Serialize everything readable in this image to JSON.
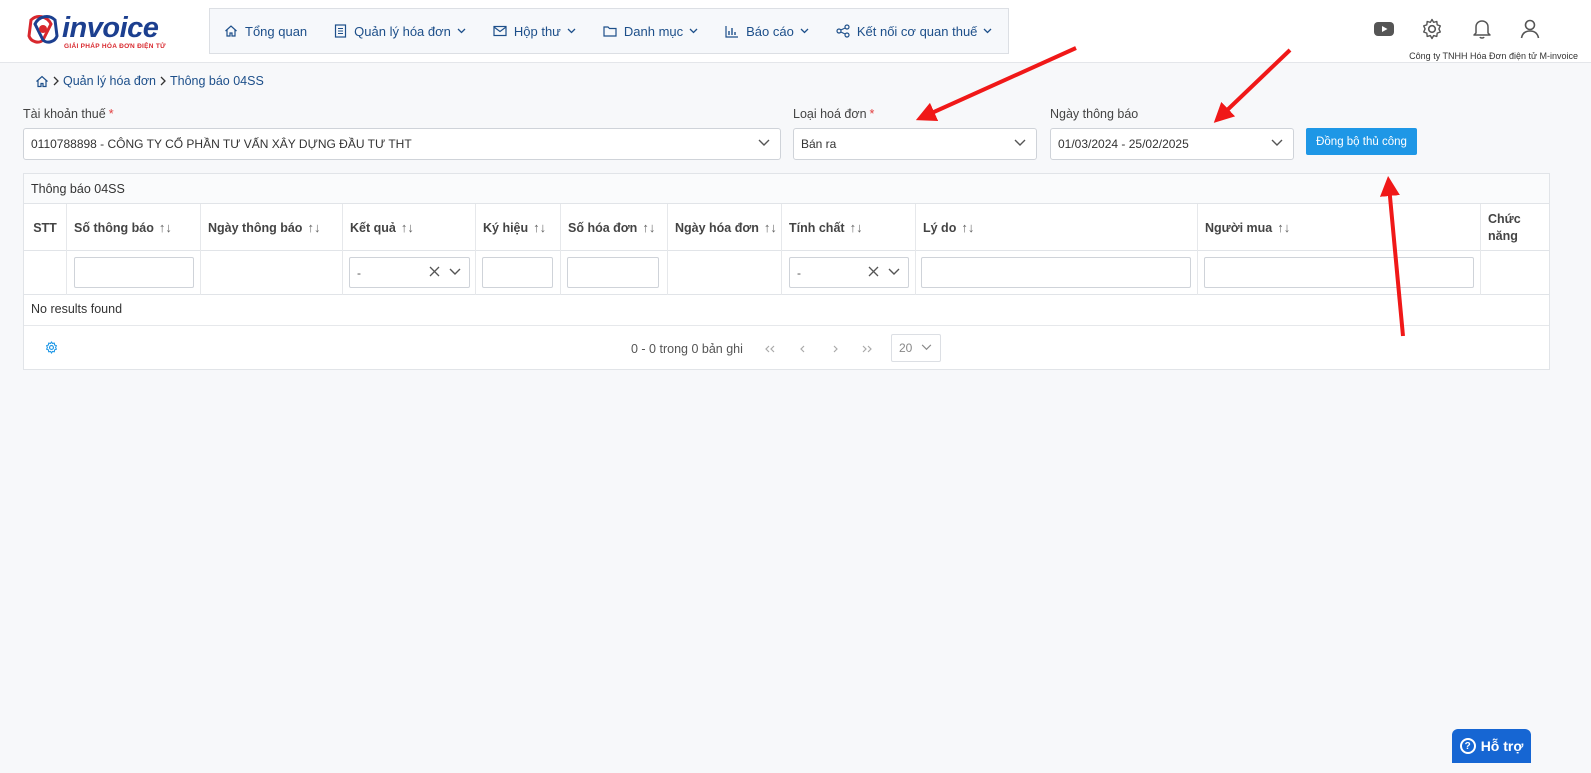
{
  "brand": {
    "name": "invoice",
    "tagline": "GIẢI PHÁP HÓA ĐƠN ĐIỆN TỬ"
  },
  "nav": {
    "items": [
      {
        "label": "Tổng quan",
        "icon": "home-icon"
      },
      {
        "label": "Quản lý hóa đơn",
        "icon": "document-icon"
      },
      {
        "label": "Hộp thư",
        "icon": "mail-icon"
      },
      {
        "label": "Danh mục",
        "icon": "folder-icon"
      },
      {
        "label": "Báo cáo",
        "icon": "chart-icon"
      },
      {
        "label": "Kết nối cơ quan thuế",
        "icon": "share-icon"
      }
    ]
  },
  "header": {
    "company": "Công ty TNHH Hóa Đơn điện tử M-invoice"
  },
  "breadcrumb": {
    "level1": "Quản lý hóa đơn",
    "level2": "Thông báo 04SS"
  },
  "filters": {
    "tax_account_label": "Tài khoản thuế",
    "tax_account_value": "0110788898 - CÔNG TY CỔ PHẦN TƯ VẤN XÂY DỰNG ĐẦU TƯ THT",
    "invoice_type_label": "Loại hoá đơn",
    "invoice_type_value": "Bán ra",
    "date_label": "Ngày thông báo",
    "date_value": "01/03/2024 - 25/02/2025",
    "required_mark": "*",
    "sync_button": "Đồng bộ thủ công"
  },
  "table": {
    "title": "Thông báo 04SS",
    "columns": [
      "STT",
      "Số thông báo",
      "Ngày thông báo",
      "Kết quả",
      "Ký hiệu",
      "Số hóa đơn",
      "Ngày hóa đơn",
      "Tính chất",
      "Lý do",
      "Người mua",
      "Chức năng"
    ],
    "sort_glyph": "↑↓",
    "filter_select_placeholder": "-",
    "empty_text": "No results found",
    "pager_text": "0 - 0 trong 0 bản ghi",
    "page_size": "20"
  },
  "help": {
    "label": "Hỗ trợ"
  },
  "colors": {
    "primary": "#1e97e6",
    "nav_text": "#1d4f8a",
    "annotation": "#f01818"
  }
}
